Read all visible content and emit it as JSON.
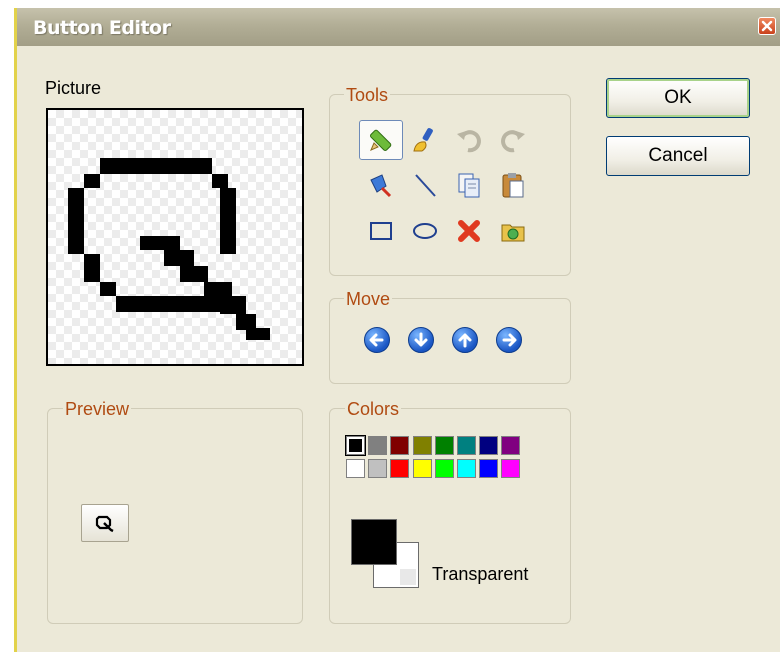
{
  "window": {
    "title": "Button Editor"
  },
  "picture": {
    "label": "Picture"
  },
  "tools": {
    "label": "Tools",
    "items": [
      "pencil-icon",
      "paint-brush-icon",
      "undo-icon",
      "redo-icon",
      "fill-icon",
      "line-icon",
      "copy-icon",
      "paste-icon",
      "rectangle-icon",
      "ellipse-icon",
      "delete-icon",
      "open-icon"
    ]
  },
  "move": {
    "label": "Move",
    "items": [
      "arrow-left-icon",
      "arrow-down-icon",
      "arrow-up-icon",
      "arrow-right-icon"
    ]
  },
  "preview": {
    "label": "Preview"
  },
  "colors": {
    "label": "Colors",
    "palette": [
      "#000000",
      "#808080",
      "#800000",
      "#808000",
      "#008000",
      "#008080",
      "#000080",
      "#800080",
      "#ffffff",
      "#c0c0c0",
      "#ff0000",
      "#ffff00",
      "#00ff00",
      "#00ffff",
      "#0000ff",
      "#ff00ff"
    ],
    "foreground": "#000000",
    "background": "#ffffff",
    "transparent_label": "Transparent"
  },
  "buttons": {
    "ok": "OK",
    "cancel": "Cancel"
  }
}
